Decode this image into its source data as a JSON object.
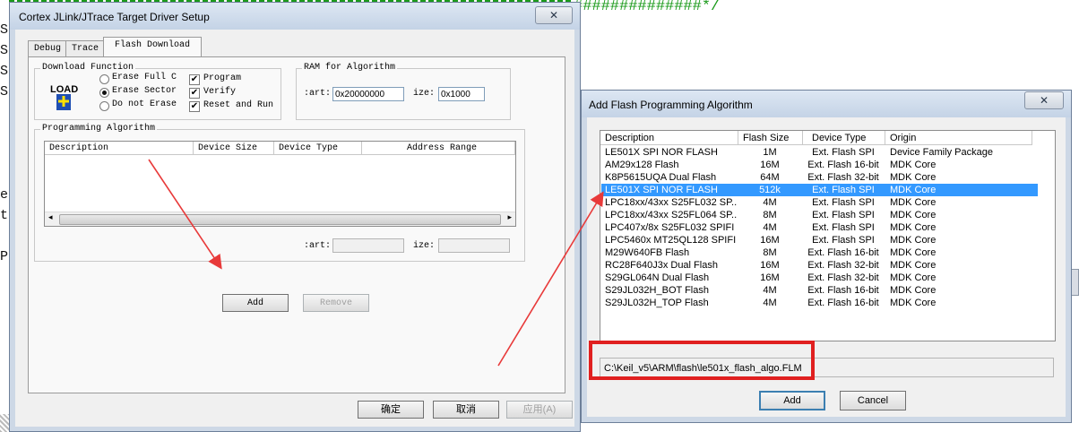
{
  "colors": {
    "arrow": "#e83a3a",
    "selection": "#3399ff",
    "code_comment": "#1a9a1a"
  },
  "background": {
    "left_letters": [
      "S",
      "S",
      "S",
      "S",
      "",
      "",
      "",
      "",
      "e",
      "t",
      "",
      "",
      "P"
    ],
    "comment_tail": "##############*/"
  },
  "target_dialog": {
    "title": "Cortex JLink/JTrace Target Driver Setup",
    "close_glyph": "✕",
    "tabs": [
      "Debug",
      "Trace",
      "Flash Download"
    ],
    "download_function": {
      "label": "Download Function",
      "icon_text": "LOAD",
      "options": [
        "Erase Full C",
        "Erase Sector",
        "Do not Erase"
      ],
      "selected_option": "Erase Sector",
      "checks": [
        "Program",
        "Verify",
        "Reset and Run"
      ]
    },
    "ram": {
      "label": "RAM for Algorithm",
      "start_label": ":art:",
      "start_value": "0x20000000",
      "size_label": "ize:",
      "size_value": "0x1000"
    },
    "programming": {
      "label": "Programming Algorithm",
      "columns": [
        "Description",
        "Device Size",
        "Device Type",
        "Address Range"
      ],
      "start_label": ":art:",
      "size_label": "ize:"
    },
    "add_button": "Add",
    "remove_button": "Remove",
    "ok_button": "确定",
    "cancel_button": "取消",
    "apply_button": "应用(A)"
  },
  "algo_dialog": {
    "title": "Add Flash Programming Algorithm",
    "close_glyph": "✕",
    "columns": [
      "Description",
      "Flash Size",
      "Device Type",
      "Origin"
    ],
    "rows": [
      {
        "desc": "LE501X SPI NOR FLASH",
        "size": "1M",
        "type": "Ext. Flash SPI",
        "origin": "Device Family Package",
        "selected": false
      },
      {
        "desc": "AM29x128 Flash",
        "size": "16M",
        "type": "Ext. Flash 16-bit",
        "origin": "MDK Core",
        "selected": false
      },
      {
        "desc": "K8P5615UQA Dual Flash",
        "size": "64M",
        "type": "Ext. Flash 32-bit",
        "origin": "MDK Core",
        "selected": false
      },
      {
        "desc": "LE501X SPI NOR FLASH",
        "size": "512k",
        "type": "Ext. Flash SPI",
        "origin": "MDK Core",
        "selected": true
      },
      {
        "desc": "LPC18xx/43xx S25FL032 SP...",
        "size": "4M",
        "type": "Ext. Flash SPI",
        "origin": "MDK Core",
        "selected": false
      },
      {
        "desc": "LPC18xx/43xx S25FL064 SP...",
        "size": "8M",
        "type": "Ext. Flash SPI",
        "origin": "MDK Core",
        "selected": false
      },
      {
        "desc": "LPC407x/8x S25FL032 SPIFI",
        "size": "4M",
        "type": "Ext. Flash SPI",
        "origin": "MDK Core",
        "selected": false
      },
      {
        "desc": "LPC5460x MT25QL128 SPIFI",
        "size": "16M",
        "type": "Ext. Flash SPI",
        "origin": "MDK Core",
        "selected": false
      },
      {
        "desc": "M29W640FB Flash",
        "size": "8M",
        "type": "Ext. Flash 16-bit",
        "origin": "MDK Core",
        "selected": false
      },
      {
        "desc": "RC28F640J3x Dual Flash",
        "size": "16M",
        "type": "Ext. Flash 32-bit",
        "origin": "MDK Core",
        "selected": false
      },
      {
        "desc": "S29GL064N Dual Flash",
        "size": "16M",
        "type": "Ext. Flash 32-bit",
        "origin": "MDK Core",
        "selected": false
      },
      {
        "desc": "S29JL032H_BOT Flash",
        "size": "4M",
        "type": "Ext. Flash 16-bit",
        "origin": "MDK Core",
        "selected": false
      },
      {
        "desc": "S29JL032H_TOP Flash",
        "size": "4M",
        "type": "Ext. Flash 16-bit",
        "origin": "MDK Core",
        "selected": false
      }
    ],
    "path": "C:\\Keil_v5\\ARM\\flash\\le501x_flash_algo.FLM",
    "add_button": "Add",
    "cancel_button": "Cancel"
  }
}
